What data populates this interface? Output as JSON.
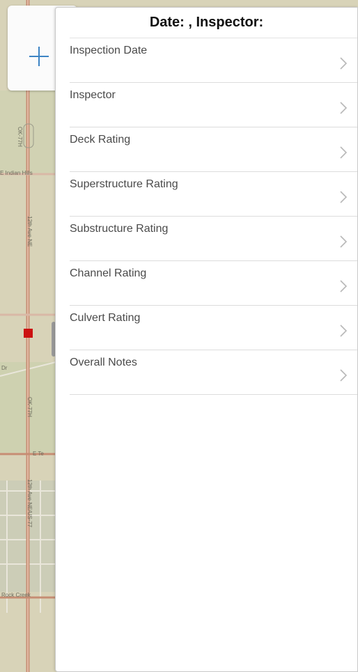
{
  "header": {
    "title": "Date:  , Inspector:"
  },
  "add_button": {
    "icon": "plus-icon",
    "color": "#3d84c4"
  },
  "fields": [
    {
      "label": "Inspection Date"
    },
    {
      "label": "Inspector"
    },
    {
      "label": "Deck Rating"
    },
    {
      "label": "Superstructure Rating"
    },
    {
      "label": "Substructure Rating"
    },
    {
      "label": "Channel Rating"
    },
    {
      "label": "Culvert Rating"
    },
    {
      "label": "Overall Notes"
    }
  ],
  "map": {
    "labels": [
      "OK-77H",
      "E Indian Hills",
      "12th Ave NE",
      "OK-77H",
      "E Te",
      "12th Ave NE/US-77",
      "Rock Creek",
      "Dr"
    ],
    "marker_color": "#cc1111"
  }
}
